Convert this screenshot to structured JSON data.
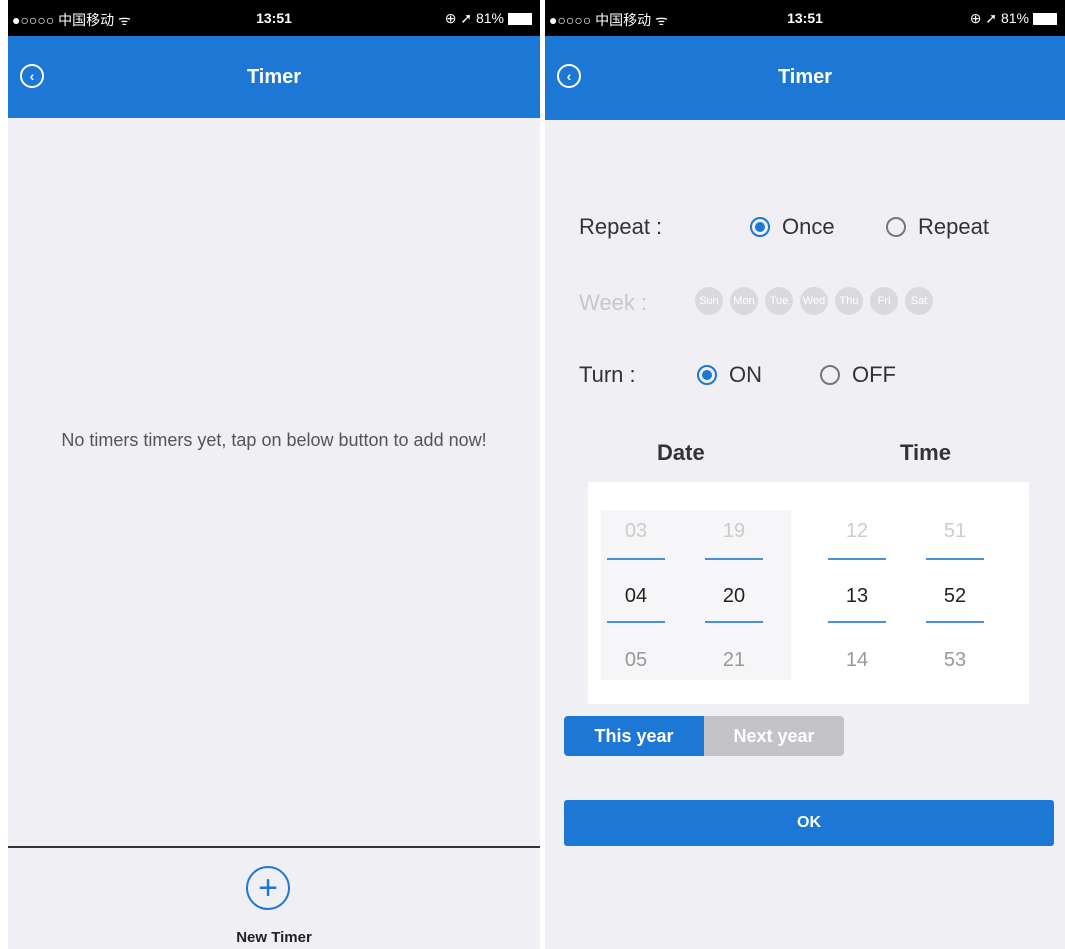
{
  "status": {
    "carrier": "●○○○○ 中国移动 ᯤ",
    "time": "13:51",
    "battery": "⊕ ➚ 81%"
  },
  "left": {
    "title": "Timer",
    "empty_message": "No timers timers yet, tap on below button to add now!",
    "new_timer_label": "New Timer"
  },
  "right": {
    "title": "Timer",
    "repeat_label": "Repeat :",
    "repeat_options": [
      "Once",
      "Repeat"
    ],
    "week_label": "Week :",
    "days": [
      "Sun",
      "Mon",
      "Tue",
      "Wed",
      "Thu",
      "Fri",
      "Sat"
    ],
    "turn_label": "Turn :",
    "turn_options": [
      "ON",
      "OFF"
    ],
    "date_header": "Date",
    "time_header": "Time",
    "picker": {
      "month": [
        "03",
        "04",
        "05"
      ],
      "day": [
        "19",
        "20",
        "21"
      ],
      "hour": [
        "12",
        "13",
        "14"
      ],
      "minute": [
        "51",
        "52",
        "53"
      ]
    },
    "year_tabs": [
      "This year",
      "Next year"
    ],
    "ok_label": "OK"
  }
}
